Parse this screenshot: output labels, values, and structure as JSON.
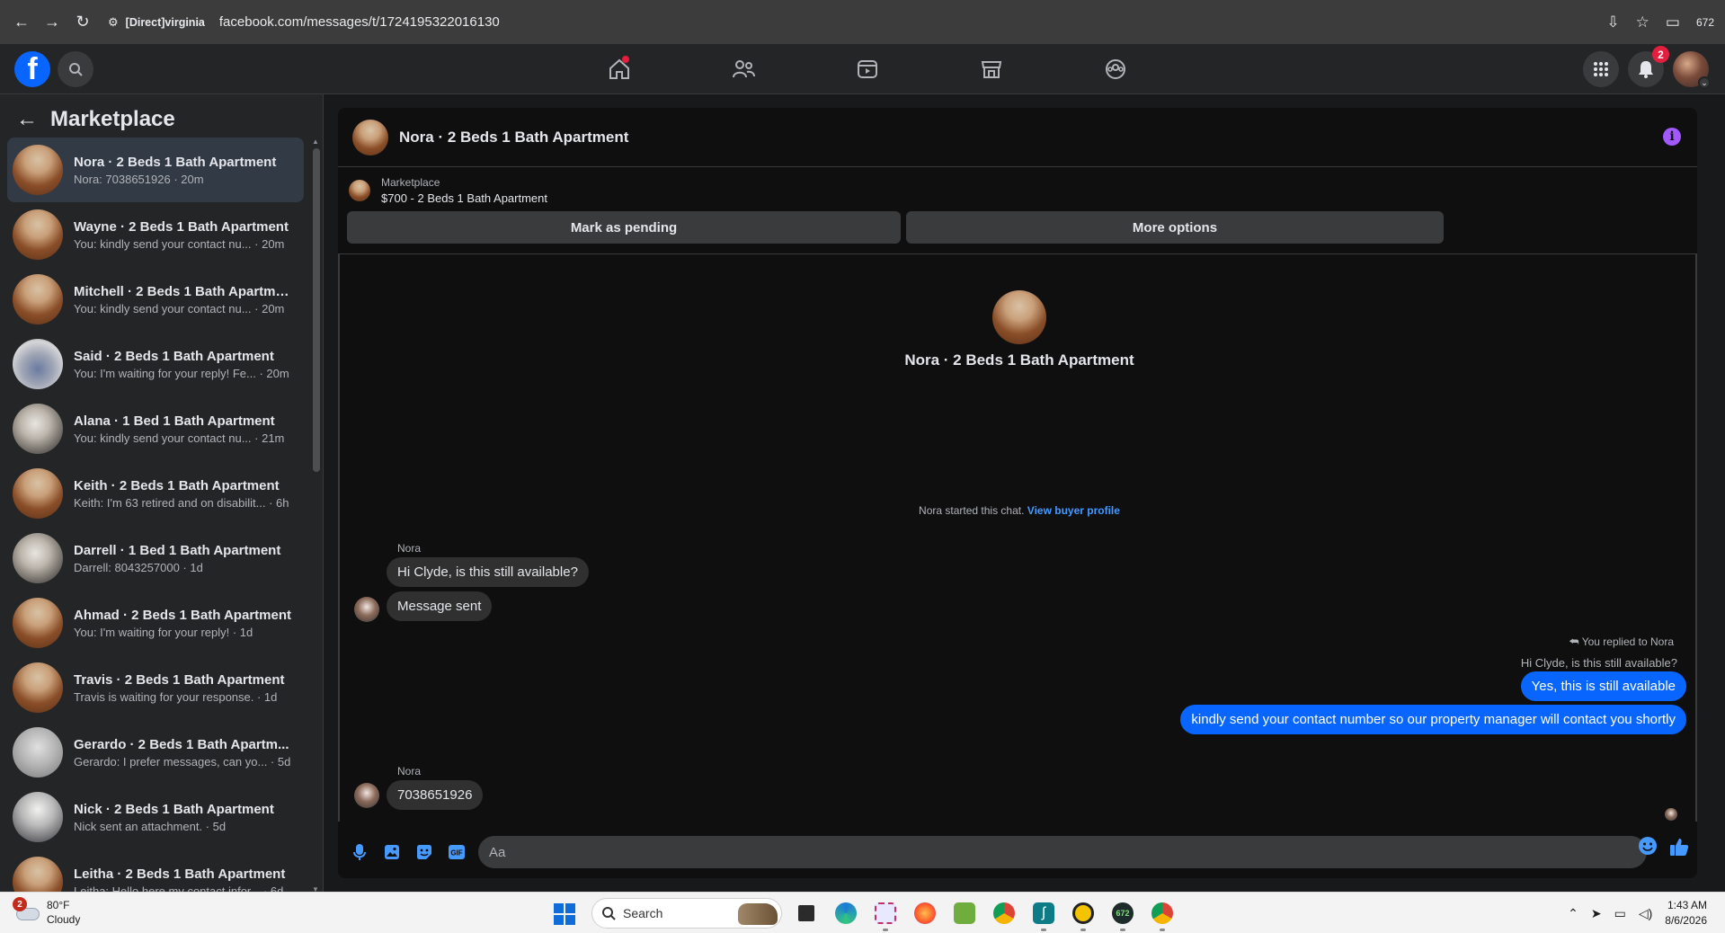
{
  "browser": {
    "ext_label": "[Direct]virginia",
    "url": "facebook.com/messages/t/1724195322016130",
    "tab_count": "672"
  },
  "fb": {
    "notif_count": "2"
  },
  "sidebar": {
    "title": "Marketplace",
    "conversations": [
      {
        "name": "Nora · 2 Beds 1 Bath Apartment",
        "last": "Nora: 7038651926 · 20m",
        "img": "wood",
        "active": true
      },
      {
        "name": "Wayne · 2 Beds 1 Bath Apartment",
        "last": "You: kindly send your contact nu... · 20m",
        "img": "wood"
      },
      {
        "name": "Mitchell · 2 Beds 1 Bath Apartme...",
        "last": "You: kindly send your contact nu... · 20m",
        "img": "wood"
      },
      {
        "name": "Said · 2 Beds 1 Bath Apartment",
        "last": "You: I'm waiting for your reply! Fe... · 20m",
        "img": "blue"
      },
      {
        "name": "Alana · 1 Bed 1 Bath Apartment",
        "last": "You: kindly send your contact nu... · 21m",
        "img": "room"
      },
      {
        "name": "Keith · 2 Beds 1 Bath Apartment",
        "last": "Keith: I'm 63 retired and on disabilit... · 6h",
        "img": "wood"
      },
      {
        "name": "Darrell · 1 Bed 1 Bath Apartment",
        "last": "Darrell: 8043257000 · 1d",
        "img": "room"
      },
      {
        "name": "Ahmad · 2 Beds 1 Bath Apartment",
        "last": "You: I'm waiting for your reply! · 1d",
        "img": "wood"
      },
      {
        "name": "Travis · 2 Beds 1 Bath Apartment",
        "last": "Travis is waiting for your response. · 1d",
        "img": "wood"
      },
      {
        "name": "Gerardo · 2 Beds 1 Bath Apartm...",
        "last": "Gerardo: I prefer messages, can yo... · 5d",
        "img": "gray"
      },
      {
        "name": "Nick · 2 Beds 1 Bath Apartment",
        "last": "Nick sent an attachment. · 5d",
        "img": "window"
      },
      {
        "name": "Leitha · 2 Beds 1 Bath Apartment",
        "last": "Leitha: Hello here my contact infor... · 6d",
        "img": "wood"
      }
    ]
  },
  "chat": {
    "title": "Nora · 2 Beds 1 Bath Apartment",
    "listing_label": "Marketplace",
    "listing_title": "$700 - 2 Beds 1 Bath Apartment",
    "mark_pending": "Mark as pending",
    "more_options": "More options",
    "intro_name": "Nora · 2 Beds 1 Bath Apartment",
    "started_text": "Nora started this chat.",
    "view_profile": "View buyer profile",
    "sender1": "Nora",
    "msg1": "Hi Clyde, is this still available?",
    "msg2": "Message sent",
    "reply_note": "You replied to Nora",
    "quoted": "Hi Clyde, is this still available?",
    "out1": "Yes, this is still available",
    "out2": "kindly send your contact number so our property manager will contact you shortly",
    "sender2": "Nora",
    "msg3": "7038651926",
    "composer_placeholder": "Aa"
  },
  "taskbar": {
    "weather_badge": "2",
    "temp": "80°F",
    "condition": "Cloudy",
    "search": "Search",
    "time": "1:43 AM",
    "date": "8/6/2026",
    "app_badge": "672"
  }
}
